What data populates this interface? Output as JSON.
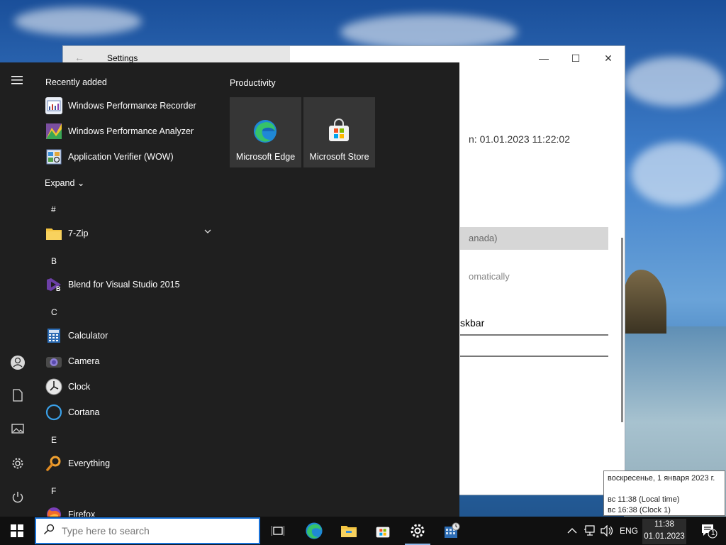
{
  "settings_window": {
    "title": "Settings",
    "back_glyph": "←",
    "minimize_glyph": "—",
    "maximize_glyph": "☐",
    "close_glyph": "✕",
    "partial_text_date": "n: 01.01.2023 11:22:02",
    "partial_text_region": "anada)",
    "partial_text_auto": "omatically",
    "partial_text_taskbar": "skbar"
  },
  "start_menu": {
    "recently_added_label": "Recently added",
    "recent_apps": [
      {
        "label": "Windows Performance Recorder",
        "icon": "performance-recorder-icon"
      },
      {
        "label": "Windows Performance Analyzer",
        "icon": "performance-analyzer-icon"
      },
      {
        "label": "Application Verifier (WOW)",
        "icon": "application-verifier-icon"
      }
    ],
    "expand_label": "Expand",
    "groups": [
      {
        "letter": "#",
        "apps": [
          {
            "label": "7-Zip",
            "icon": "folder-icon"
          }
        ]
      },
      {
        "letter": "B",
        "apps": [
          {
            "label": "Blend for Visual Studio 2015",
            "icon": "blend-icon"
          }
        ]
      },
      {
        "letter": "C",
        "apps": [
          {
            "label": "Calculator",
            "icon": "calculator-icon"
          },
          {
            "label": "Camera",
            "icon": "camera-icon"
          },
          {
            "label": "Clock",
            "icon": "clock-icon"
          },
          {
            "label": "Cortana",
            "icon": "cortana-icon"
          }
        ]
      },
      {
        "letter": "E",
        "apps": [
          {
            "label": "Everything",
            "icon": "search-magnifier-icon"
          }
        ]
      },
      {
        "letter": "F",
        "apps": [
          {
            "label": "Firefox",
            "icon": "firefox-icon"
          }
        ]
      }
    ],
    "tiles_header": "Productivity",
    "tiles": [
      {
        "label": "Microsoft Edge",
        "icon": "edge-icon"
      },
      {
        "label": "Microsoft Store",
        "icon": "store-icon"
      }
    ]
  },
  "tooltip": {
    "date_line": "воскресенье, 1 января 2023 г.",
    "local_time_line": "вс 11:38  (Local time)",
    "clock1_line": "вс 16:38  (Clock 1)"
  },
  "taskbar": {
    "search_placeholder": "Type here to search",
    "language": "ENG",
    "time": "11:38",
    "date": "01.01.2023",
    "notification_count": "1"
  },
  "colors": {
    "accent": "#1a73d9",
    "start_bg": "#1f1f1f",
    "tile_bg": "#363636",
    "taskbar_bg": "#101010"
  }
}
